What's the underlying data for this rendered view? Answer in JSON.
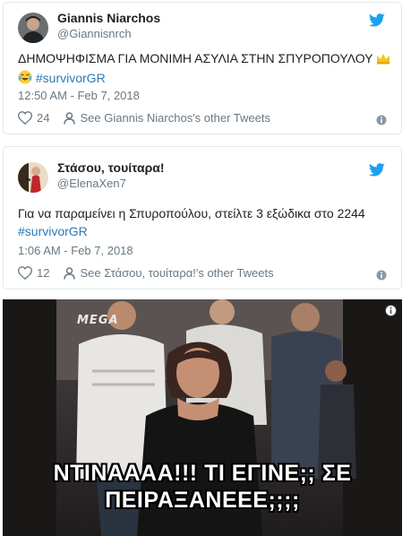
{
  "tweets": [
    {
      "name": "Giannis Niarchos",
      "handle": "@Giannisnrch",
      "text": "ΔΗΜΟΨΗΦΙΣΜΑ ΓΙΑ ΜΟΝΙΜΗ ΑΣΥΛΙΑ ΣΤΗΝ ΣΠΥΡΟΠΟΥΛΟΥ",
      "text_emoji": "crown-icon",
      "line2_emoji": "tears-of-joy-icon",
      "hashtag": "#survivorGR",
      "timestamp": "12:50 AM - Feb 7, 2018",
      "likes": "24",
      "other_tweets": "See Giannis Niarchos's other Tweets"
    },
    {
      "name": "Στάσου, τουίταρα!",
      "handle": "@ElenaXen7",
      "text": "Για να παραμείνει η Σπυροπούλου, στείλτε 3 εξώδικα στο 2244",
      "hashtag": "#survivorGR",
      "timestamp": "1:06 AM - Feb 7, 2018",
      "likes": "12",
      "other_tweets": "See Στάσου, τουίταρα!'s other Tweets"
    }
  ],
  "video": {
    "logo": "MEGA",
    "subtitle_line1": "ΝΤΙΝΑΑΑΑ!!! ΤΙ ΕΓΙΝΕ;; ΣΕ",
    "subtitle_line2": "ΠΕΙΡΑΞΑΝΕΕΕ;;;;"
  },
  "icons": {
    "bird": "twitter-bird-icon",
    "heart": "heart-icon",
    "person": "person-icon",
    "info": "info-icon"
  },
  "colors": {
    "link": "#2b7bb9",
    "bird": "#1da1f2",
    "muted": "#697882",
    "border": "#e1e8ed"
  }
}
